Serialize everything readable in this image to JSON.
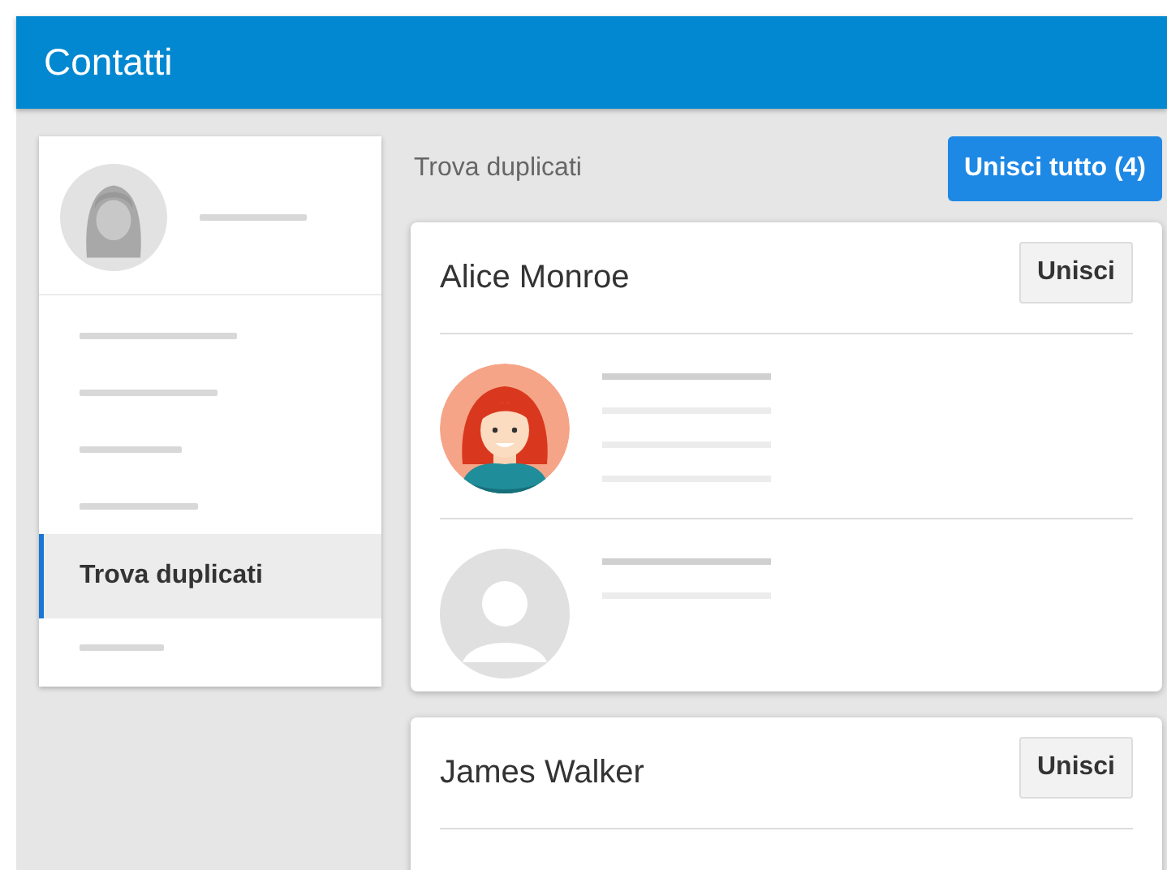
{
  "app_bar": {
    "title": "Contatti"
  },
  "sidebar": {
    "items": [
      {
        "kind": "placeholder",
        "selected": false
      },
      {
        "kind": "placeholder",
        "selected": false
      },
      {
        "kind": "placeholder",
        "selected": false
      },
      {
        "kind": "placeholder",
        "selected": false
      },
      {
        "kind": "link",
        "label": "Trova duplicati",
        "selected": true
      },
      {
        "kind": "placeholder",
        "selected": false
      }
    ]
  },
  "main": {
    "heading": "Trova duplicati",
    "merge_all_button": "Unisci tutto (4)",
    "groups": [
      {
        "name": "Alice Monroe",
        "merge_button": "Unisci",
        "contacts": [
          {
            "kind": "illustrated"
          },
          {
            "kind": "generic"
          }
        ]
      },
      {
        "name": "James Walker",
        "merge_button": "Unisci"
      }
    ]
  }
}
